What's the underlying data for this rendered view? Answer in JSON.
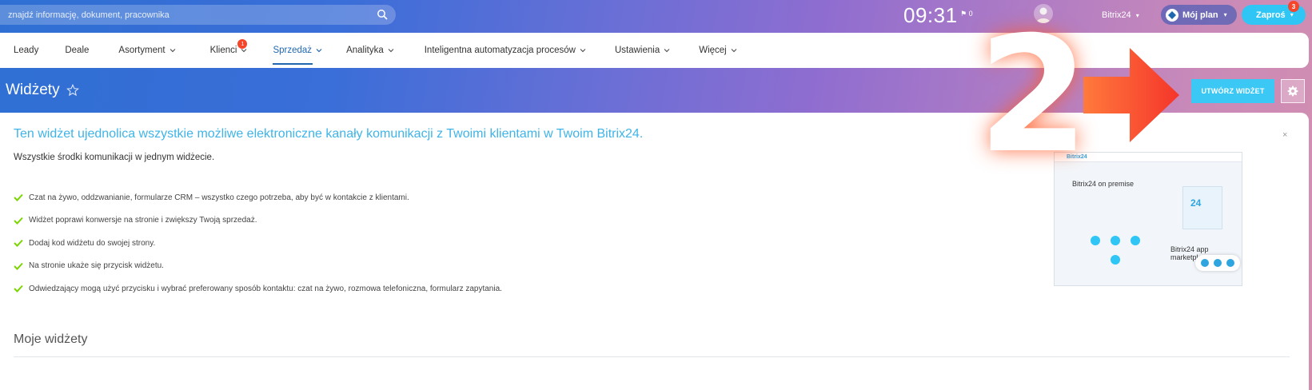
{
  "topbar": {
    "search_placeholder": "znajdź informację, dokument, pracownika",
    "clock": "09:31",
    "flag_count": "0",
    "user_name": "Bitrix24",
    "plan_label": "Mój plan",
    "invite_label": "Zaproś",
    "invite_badge": "3"
  },
  "nav": {
    "items": [
      {
        "label": "Leady"
      },
      {
        "label": "Deale"
      },
      {
        "label": "Asortyment"
      },
      {
        "label": "Klienci",
        "badge": "1"
      },
      {
        "label": "Sprzedaż",
        "active": true
      },
      {
        "label": "Analityka"
      },
      {
        "label": "Inteligentna automatyzacja procesów"
      },
      {
        "label": "Ustawienia"
      },
      {
        "label": "Więcej"
      }
    ]
  },
  "page": {
    "title": "Widżety",
    "create_button": "UTWÓRZ WIDŻET"
  },
  "intro": {
    "heading": "Ten widżet ujednolica wszystkie możliwe elektroniczne kanały komunikacji z Twoimi klientami w Twoim Bitrix24.",
    "subheading": "Wszystkie środki komunikacji w jednym widżecie.",
    "features": [
      "Czat na żywo, oddzwanianie, formularze CRM – wszystko czego potrzeba, aby być w kontakcie z klientami.",
      "Widżet poprawi konwersje na stronie i zwiększy Twoją sprzedaż.",
      "Dodaj kod widżetu do swojej strony.",
      "Na stronie ukaże się przycisk widżetu.",
      "Odwiedzający mogą użyć przycisku i wybrać preferowany sposób kontaktu: czat na żywo, rozmowa telefoniczna, formularz zapytania."
    ],
    "close": "×"
  },
  "preview": {
    "logo": "Bitrix24",
    "title1": "Bitrix24 on premise",
    "title2": "Bitrix24 app marketplace",
    "tag": "24"
  },
  "my_widgets": {
    "title": "Moje widżety"
  },
  "annotation": {
    "step_number": "2",
    "arrow_color": "#f5452b"
  }
}
